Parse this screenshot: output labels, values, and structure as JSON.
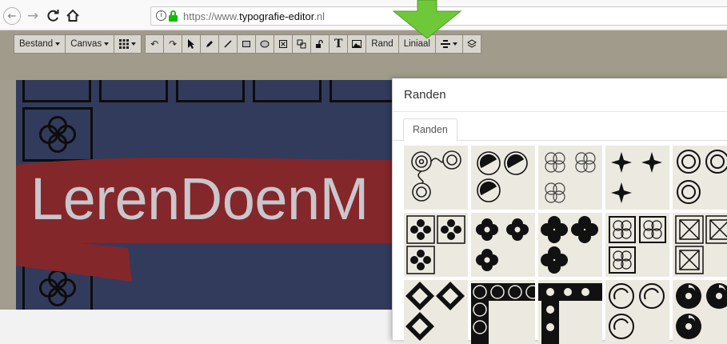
{
  "browser": {
    "back_icon": "arrow-left-icon",
    "forward_icon": "arrow-right-icon",
    "reload_icon": "reload-icon",
    "home_icon": "home-icon",
    "url_scheme": "https://www.",
    "url_host": "typografie-editor",
    "url_tld": ".nl"
  },
  "toolbar": {
    "file_label": "Bestand",
    "canvas_label": "Canvas",
    "border_label": "Rand",
    "ruler_label": "Liniaal",
    "text_tool_label": "T"
  },
  "canvas": {
    "banner_text": "LerenDoenM",
    "background_color": "#323b5c",
    "banner_color": "#84272a"
  },
  "panel": {
    "title": "Randen",
    "tab_label": "Randen"
  },
  "colors": {
    "highlight_arrow": "#6fc73a",
    "tile_background": "#ece9e0"
  }
}
